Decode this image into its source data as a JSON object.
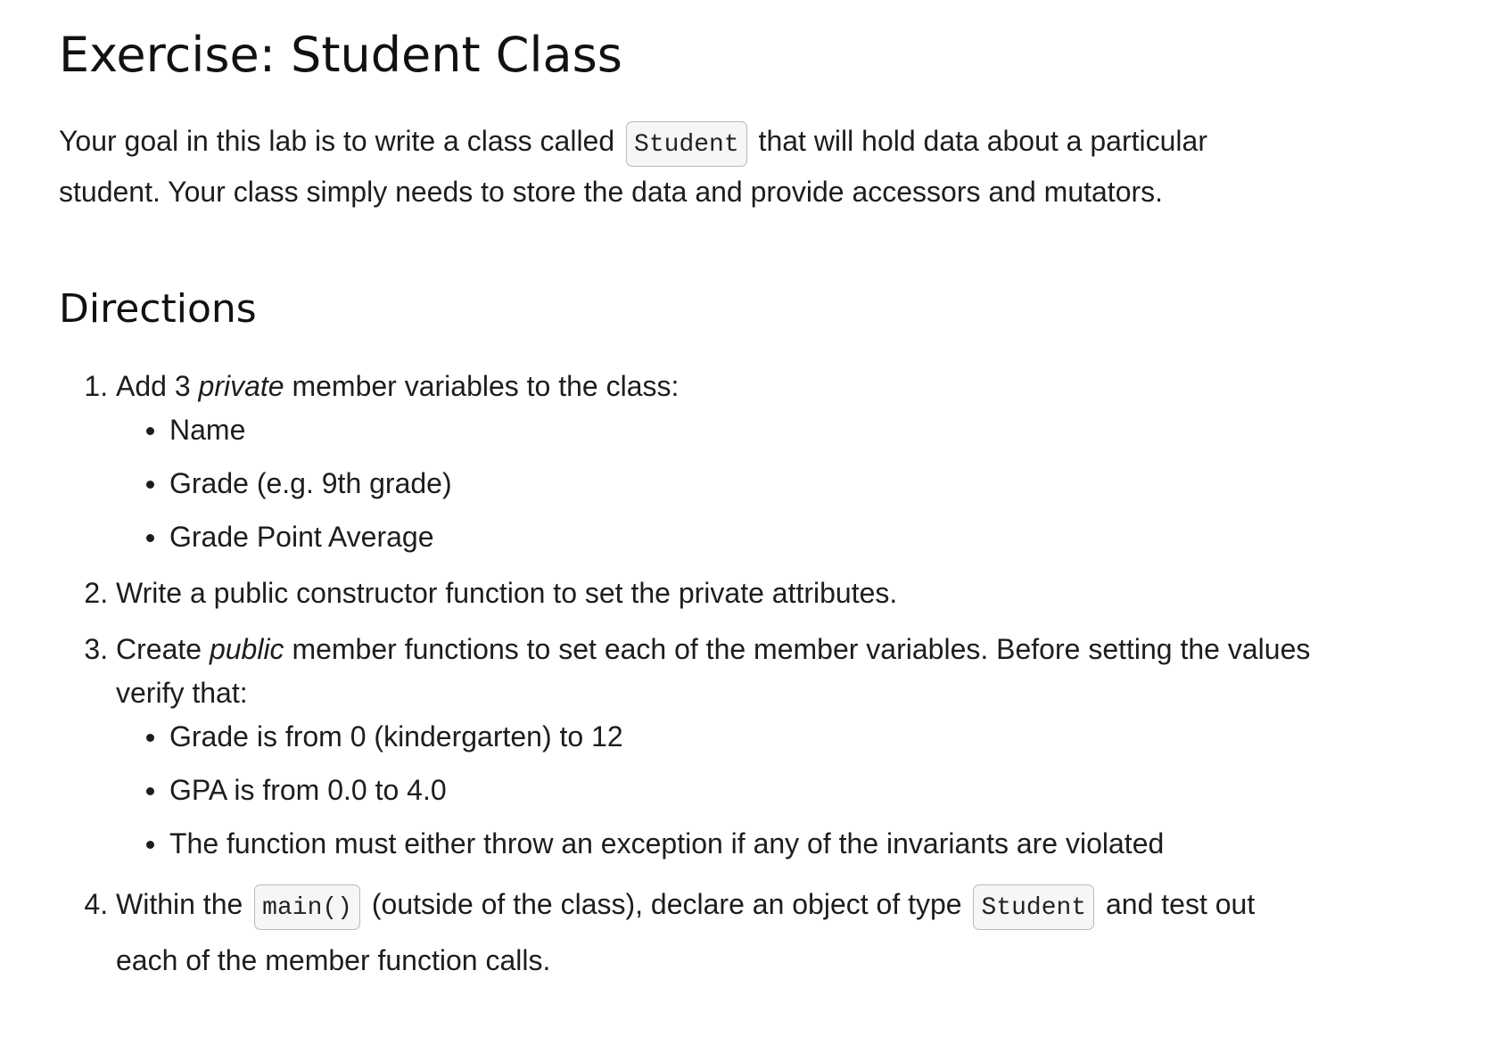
{
  "title": "Exercise: Student Class",
  "intro": {
    "before": "Your goal in this lab is to write a class called",
    "code": "Student",
    "after": "that will hold data about a particular student. Your class simply needs to store the data and provide accessors and mutators."
  },
  "directions_heading": "Directions",
  "steps": [
    {
      "before": "Add 3",
      "em": "private",
      "after": "member variables to the class:",
      "bullets": [
        "Name",
        "Grade (e.g. 9th grade)",
        "Grade Point Average"
      ]
    },
    {
      "text": "Write a public constructor function to set the private attributes."
    },
    {
      "before": "Create",
      "em": "public",
      "after": "member functions to set each of the member variables. Before setting the values verify that:",
      "bullets": [
        "Grade is from 0 (kindergarten) to 12",
        "GPA is from 0.0 to 4.0",
        "The function must either throw an exception if any of the invariants are violated"
      ]
    },
    {
      "before": "Within the",
      "code1": "main()",
      "middle": "(outside of the class), declare an object of type",
      "code2": "Student",
      "after": "and test out each of the member function calls."
    }
  ]
}
